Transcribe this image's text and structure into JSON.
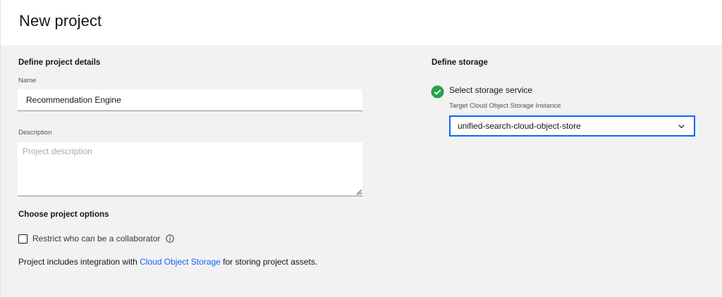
{
  "header": {
    "title": "New project"
  },
  "details": {
    "section_title": "Define project details",
    "name_label": "Name",
    "name_value": "Recommendation Engine",
    "description_label": "Description",
    "description_placeholder": "Project description"
  },
  "options": {
    "section_title": "Choose project options",
    "restrict_label": "Restrict who can be a collaborator",
    "restrict_checked": false,
    "note_prefix": "Project includes integration with ",
    "note_link": "Cloud Object Storage",
    "note_suffix": " for storing project assets."
  },
  "storage": {
    "section_title": "Define storage",
    "service_label": "Select storage service",
    "instance_label": "Target Cloud Object Storage Instance",
    "instance_value": "unified-search-cloud-object-store"
  },
  "colors": {
    "accent": "#0f62fe",
    "success": "#24a148"
  },
  "icons": [
    "check-circle-icon",
    "info-icon",
    "chevron-down-icon",
    "resize-handle-icon"
  ]
}
